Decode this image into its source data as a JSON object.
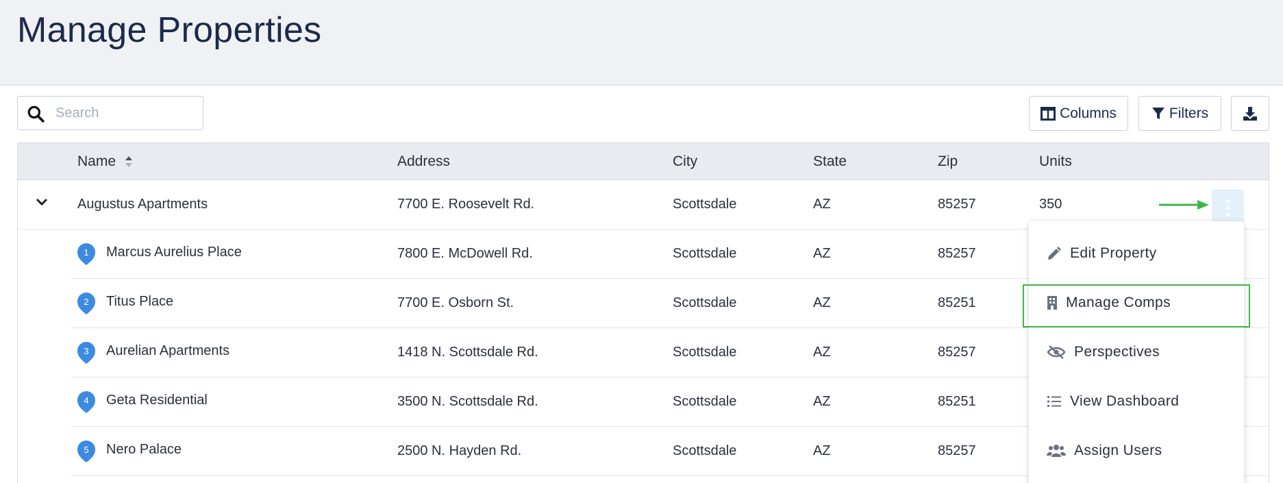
{
  "page": {
    "title": "Manage Properties"
  },
  "toolbar": {
    "search_placeholder": "Search",
    "columns_label": "Columns",
    "filters_label": "Filters"
  },
  "table": {
    "headers": {
      "name": "Name",
      "address": "Address",
      "city": "City",
      "state": "State",
      "zip": "Zip",
      "units": "Units"
    },
    "parent": {
      "name": "Augustus Apartments",
      "address": "7700 E. Roosevelt Rd.",
      "city": "Scottsdale",
      "state": "AZ",
      "zip": "85257",
      "units": "350"
    },
    "comps": [
      {
        "num": "1",
        "name": "Marcus Aurelius Place",
        "address": "7800 E. McDowell Rd.",
        "city": "Scottsdale",
        "state": "AZ",
        "zip": "85257"
      },
      {
        "num": "2",
        "name": "Titus Place",
        "address": "7700 E. Osborn St.",
        "city": "Scottsdale",
        "state": "AZ",
        "zip": "85251"
      },
      {
        "num": "3",
        "name": "Aurelian Apartments",
        "address": "1418 N. Scottsdale Rd.",
        "city": "Scottsdale",
        "state": "AZ",
        "zip": "85257"
      },
      {
        "num": "4",
        "name": "Geta Residential",
        "address": "3500 N. Scottsdale Rd.",
        "city": "Scottsdale",
        "state": "AZ",
        "zip": "85251"
      },
      {
        "num": "5",
        "name": "Nero Palace",
        "address": "2500 N. Hayden Rd.",
        "city": "Scottsdale",
        "state": "AZ",
        "zip": "85257"
      }
    ]
  },
  "menu": {
    "items": [
      {
        "label": "Edit Property",
        "icon": "pencil-icon"
      },
      {
        "label": "Manage Comps",
        "icon": "building-icon"
      },
      {
        "label": "Perspectives",
        "icon": "eye-slash-icon"
      },
      {
        "label": "View Dashboard",
        "icon": "list-icon"
      },
      {
        "label": "Assign Users",
        "icon": "users-icon"
      }
    ]
  },
  "colors": {
    "accent": "#3c8be0",
    "highlight": "#3fb548",
    "title": "#1c2a4a"
  }
}
